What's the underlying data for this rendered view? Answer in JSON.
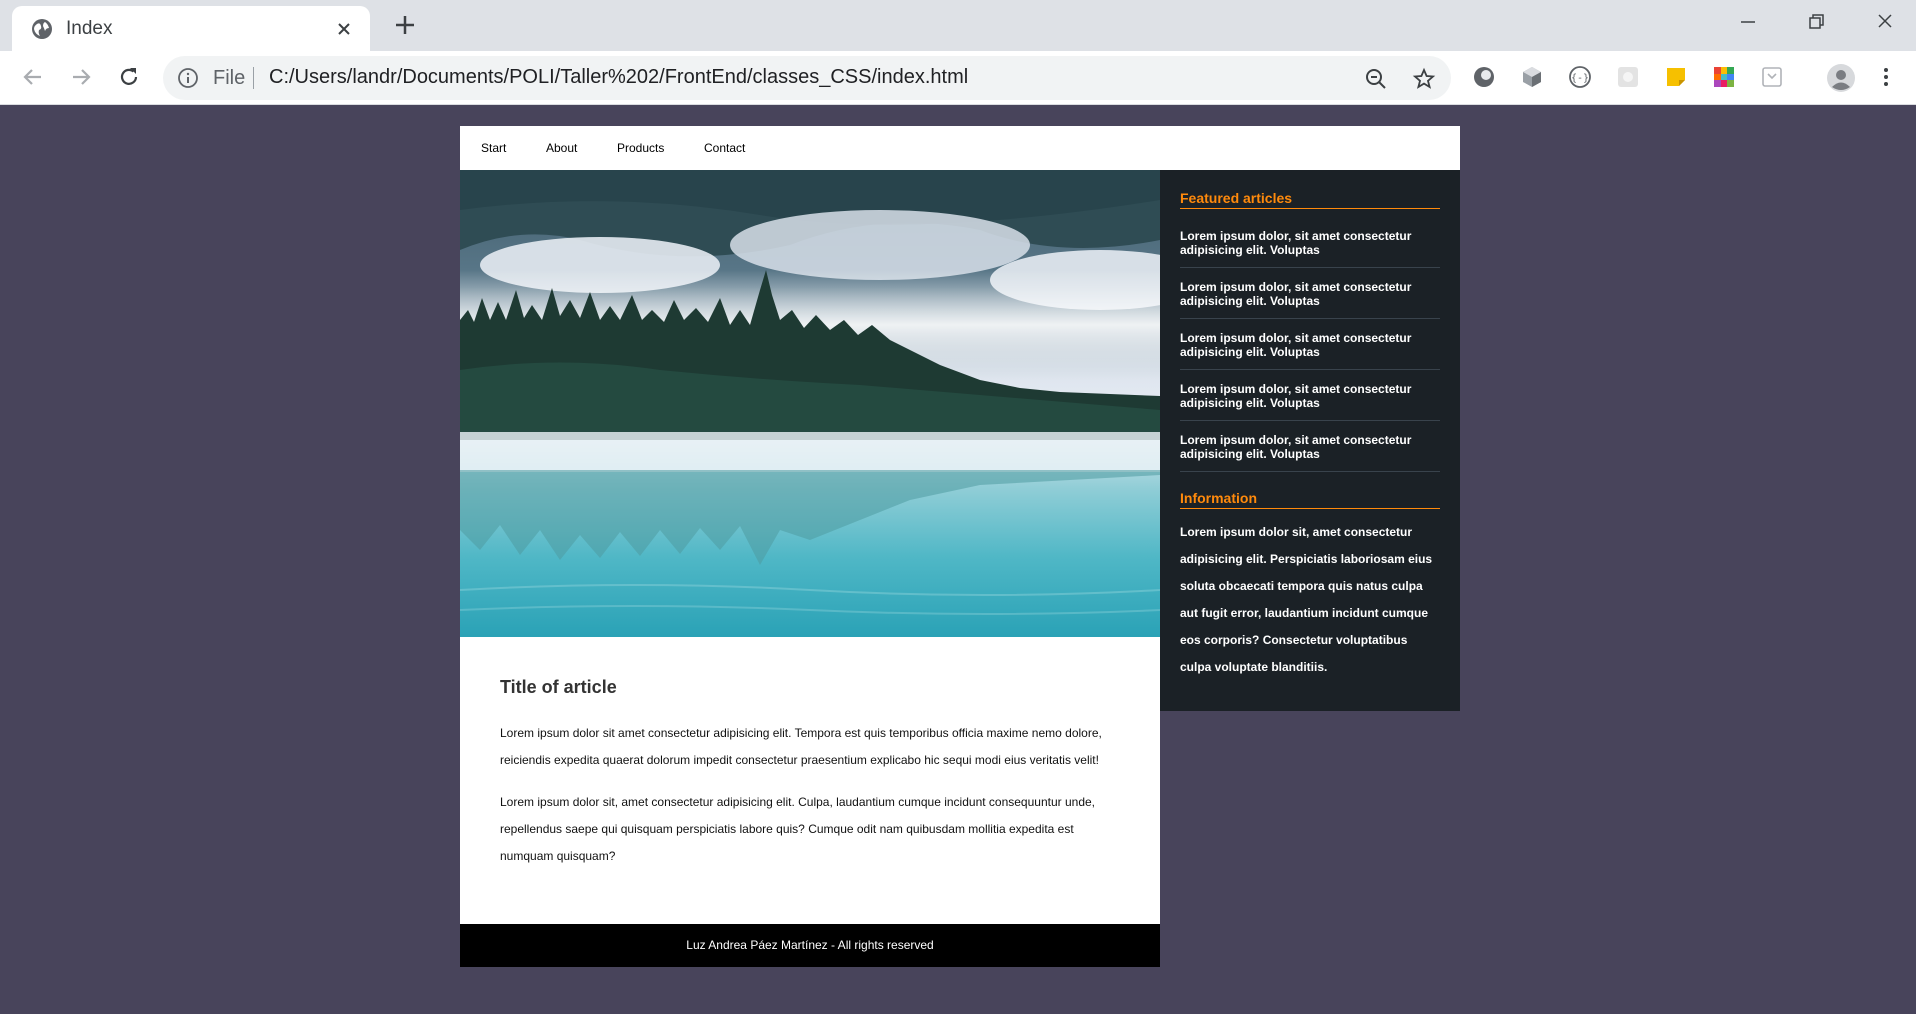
{
  "browser": {
    "tab_title": "Index",
    "address_scheme": "File",
    "address_url": "C:/Users/landr/Documents/POLI/Taller%202/FrontEnd/classes_CSS/index.html",
    "extension_icons": [
      "zoom-icon",
      "star-icon",
      "extension-circle-icon",
      "extension-cube-icon",
      "extension-braces-icon",
      "extension-gray-icon",
      "extension-sticky-note-icon",
      "extension-color-grid-icon",
      "extension-pocket-icon",
      "profile-avatar-icon",
      "menu-dots-icon"
    ]
  },
  "nav": {
    "items": [
      "Start",
      "About",
      "Products",
      "Contact"
    ]
  },
  "article": {
    "title": "Title of article",
    "paragraphs": [
      "Lorem ipsum dolor sit amet consectetur adipisicing elit. Tempora est quis temporibus officia maxime nemo dolore, reiciendis expedita quaerat dolorum impedit consectetur praesentium explicabo hic sequi modi eius veritatis velit!",
      "Lorem ipsum dolor sit, amet consectetur adipisicing elit. Culpa, laudantium cumque incidunt consequuntur unde, repellendus saepe qui quisquam perspiciatis labore quis? Cumque odit nam quibusdam mollitia expedita est numquam quisquam?"
    ]
  },
  "sidebar": {
    "featured_heading": "Featured articles",
    "featured_items": [
      "Lorem ipsum dolor, sit amet consectetur adipisicing elit. Voluptas",
      "Lorem ipsum dolor, sit amet consectetur adipisicing elit. Voluptas",
      "Lorem ipsum dolor, sit amet consectetur adipisicing elit. Voluptas",
      "Lorem ipsum dolor, sit amet consectetur adipisicing elit. Voluptas",
      "Lorem ipsum dolor, sit amet consectetur adipisicing elit. Voluptas"
    ],
    "info_heading": "Information",
    "info_text": "Lorem ipsum dolor sit, amet consectetur adipisicing elit. Perspiciatis laboriosam eius soluta obcaecati tempora quis natus culpa aut fugit error, laudantium incidunt cumque eos corporis? Consectetur voluptatibus culpa voluptate blanditiis."
  },
  "footer": {
    "text": "Luz Andrea Páez Martínez - All rights reserved"
  },
  "colors": {
    "page_background": "#48445b",
    "sidebar_background": "#1b2126",
    "accent_orange": "#ff8a0c",
    "footer_background": "#000000"
  }
}
